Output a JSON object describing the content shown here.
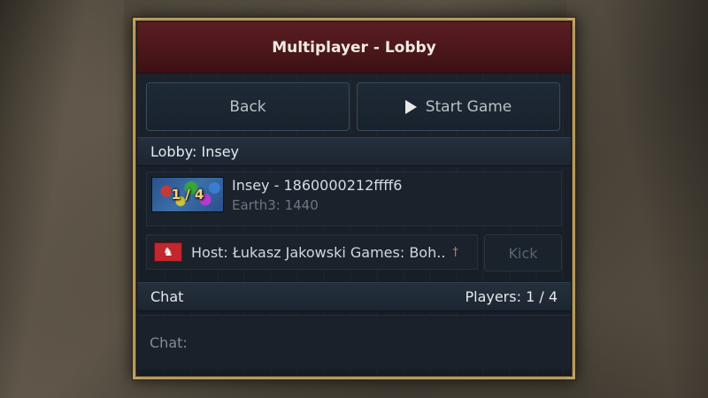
{
  "window": {
    "title": "Multiplayer - Lobby"
  },
  "buttons": {
    "back": "Back",
    "start_game": "Start Game",
    "kick": "Kick"
  },
  "lobby": {
    "header": "Lobby: Insey",
    "entry": {
      "player_count": "1 / 4",
      "name": "Insey - 1860000212ffff6",
      "map": "Earth3: 1440"
    },
    "host": {
      "text": "Host: Łukasz Jakowski Games: Boh..",
      "mark": "†",
      "flag_icon": "lion-flag-icon"
    }
  },
  "chat": {
    "header": "Chat",
    "players": "Players: 1 / 4",
    "input_label": "Chat:"
  },
  "colors": {
    "title_bar": "#4a161a",
    "panel_bg": "#1b222b",
    "frame": "#b49a5f",
    "accent_gold": "#f4d27a"
  }
}
